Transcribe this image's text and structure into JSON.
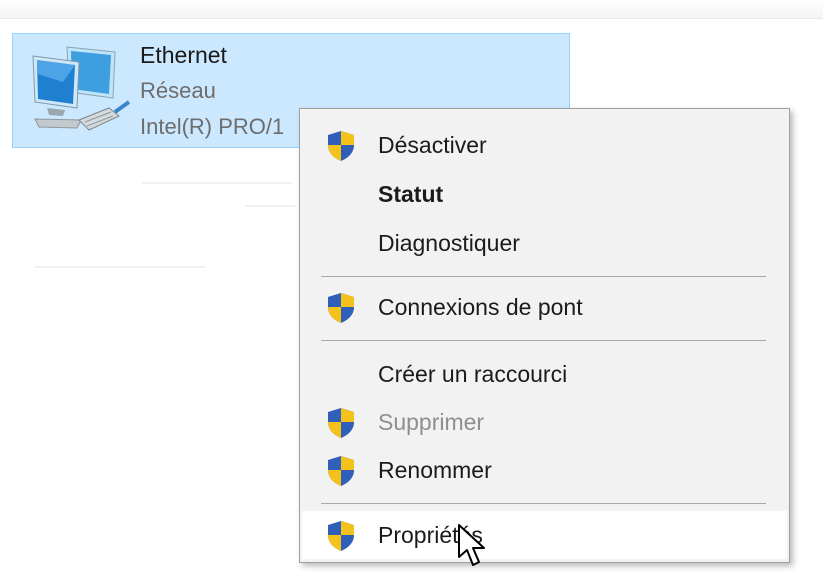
{
  "adapter": {
    "name": "Ethernet",
    "status": "Réseau",
    "device": "Intel(R) PRO/1",
    "icon": "network-adapter-icon"
  },
  "context_menu": {
    "shield_icon": "uac-shield-icon",
    "shield_colors": {
      "blue": "#2f5fb8",
      "yellow": "#f5c21b"
    },
    "items": [
      {
        "label": "Désactiver",
        "shield": true,
        "bold": false,
        "disabled": false
      },
      {
        "label": "Statut",
        "shield": false,
        "bold": true,
        "disabled": false
      },
      {
        "label": "Diagnostiquer",
        "shield": false,
        "bold": false,
        "disabled": false
      },
      {
        "label": "Connexions de pont",
        "shield": true,
        "bold": false,
        "disabled": false
      },
      {
        "label": "Créer un raccourci",
        "shield": false,
        "bold": false,
        "disabled": false
      },
      {
        "label": "Supprimer",
        "shield": true,
        "bold": false,
        "disabled": true
      },
      {
        "label": "Renommer",
        "shield": true,
        "bold": false,
        "disabled": false
      },
      {
        "label": "Propriétés",
        "shield": true,
        "bold": false,
        "disabled": false,
        "highlighted": true
      }
    ]
  },
  "cursor": "arrow-cursor-icon",
  "colors": {
    "selection_bg": "#cce8ff",
    "selection_border": "#99d1ff",
    "menu_bg": "#f2f2f2",
    "menu_hover_bg": "#ffffff"
  }
}
